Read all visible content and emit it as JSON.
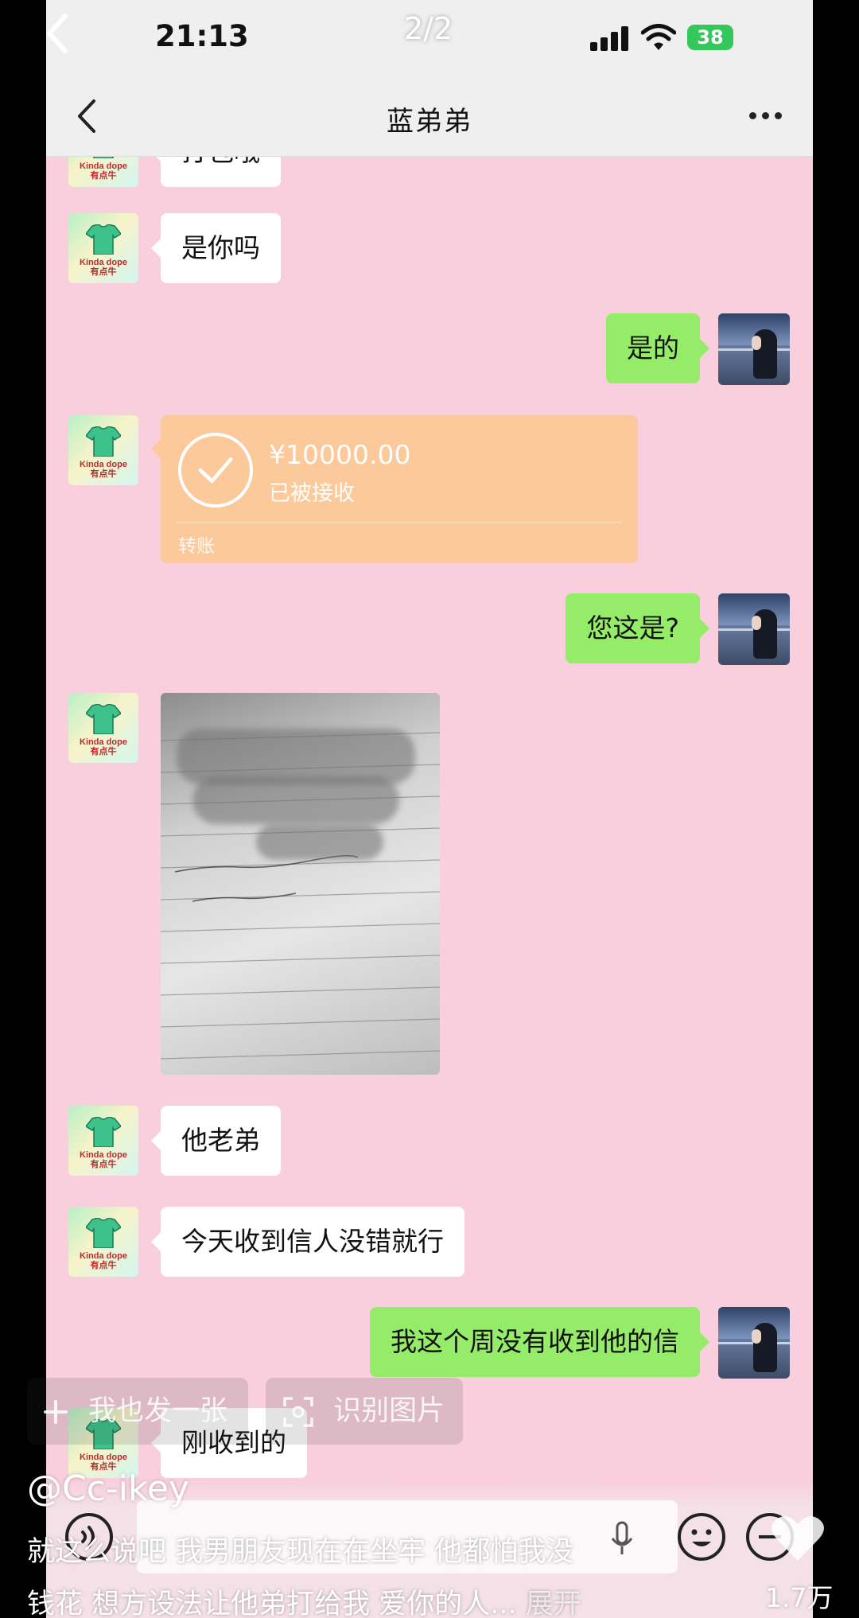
{
  "status_bar": {
    "time": "21:13",
    "page_indicator": "2/2",
    "battery": "38"
  },
  "nav": {
    "title": "蓝弟弟"
  },
  "messages": {
    "m0": "打包哦",
    "m1": "是你吗",
    "m2": "是的",
    "m3": "您这是?",
    "m4": "他老弟",
    "m5": "今天收到信人没错就行",
    "m6": "我这个周没有收到他的信",
    "m7": "刚收到的"
  },
  "transfer": {
    "amount": "¥10000.00",
    "status": "已被接收",
    "label": "转账"
  },
  "avatar_brand": {
    "line1": "Kinda dope",
    "line2": "有点牛"
  },
  "overlay": {
    "send_too": "我也发一张",
    "recognize": "识别图片",
    "author": "@Cc-ikey",
    "caption_line1": "就这么说吧 我男朋友现在在坐牢 他都怕我没",
    "caption_line2": "钱花 想方设法让他弟打给我 爱你的人...",
    "expand": "展开",
    "likes": "1.7万"
  },
  "colors": {
    "chat_bg": "#f9cedd",
    "outgoing_bubble": "#95ec69",
    "transfer_card": "#fbc99a",
    "battery": "#34c759"
  },
  "icons": [
    "back-icon",
    "more-icon",
    "check-icon",
    "plus-icon",
    "scan-icon",
    "voice-icon",
    "mic-icon",
    "emoji-icon",
    "add-icon",
    "heart-icon",
    "shirt-icon"
  ]
}
